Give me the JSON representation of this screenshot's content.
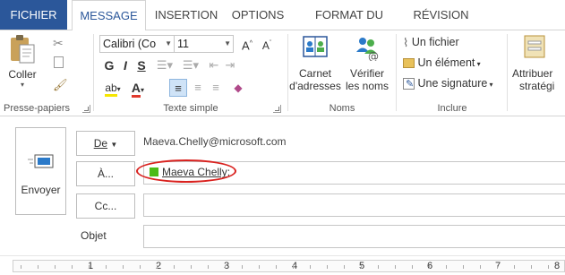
{
  "tabs": [
    "FICHIER",
    "MESSAGE",
    "INSERTION",
    "OPTIONS",
    "FORMAT DU TEXTE",
    "RÉVISION"
  ],
  "ribbon": {
    "clipboard": {
      "paste": "Coller",
      "label": "Presse-papiers"
    },
    "font": {
      "name": "Calibri (Co",
      "size": "11",
      "label": "Texte simple"
    },
    "names": {
      "address_book": [
        "Carnet",
        "d'adresses"
      ],
      "check_names": [
        "Vérifier",
        "les noms"
      ],
      "label": "Noms"
    },
    "include": {
      "file": "Un fichier",
      "item": "Un élément",
      "signature": "Une signature",
      "label": "Inclure"
    },
    "tags": {
      "assign": [
        "Attribuer",
        "stratégi"
      ]
    }
  },
  "message": {
    "send": "Envoyer",
    "from_button": "De",
    "from_value": "Maeva.Chelly@microsoft.com",
    "to_button": "À...",
    "recipient": "Maeva Chelly",
    "recipient_suffix": ";",
    "cc_button": "Cc...",
    "subject_label": "Objet",
    "subject_value": ""
  },
  "ruler": [
    "1",
    "2",
    "3",
    "4",
    "5",
    "6",
    "7",
    "8"
  ],
  "colors": {
    "file_tab": "#2b579a",
    "accent": "#2b579a",
    "highlight_oval": "#d9221f",
    "presence": "#4cbb17",
    "font_color": "#e03a2e",
    "highlight_color": "#f6e600"
  }
}
